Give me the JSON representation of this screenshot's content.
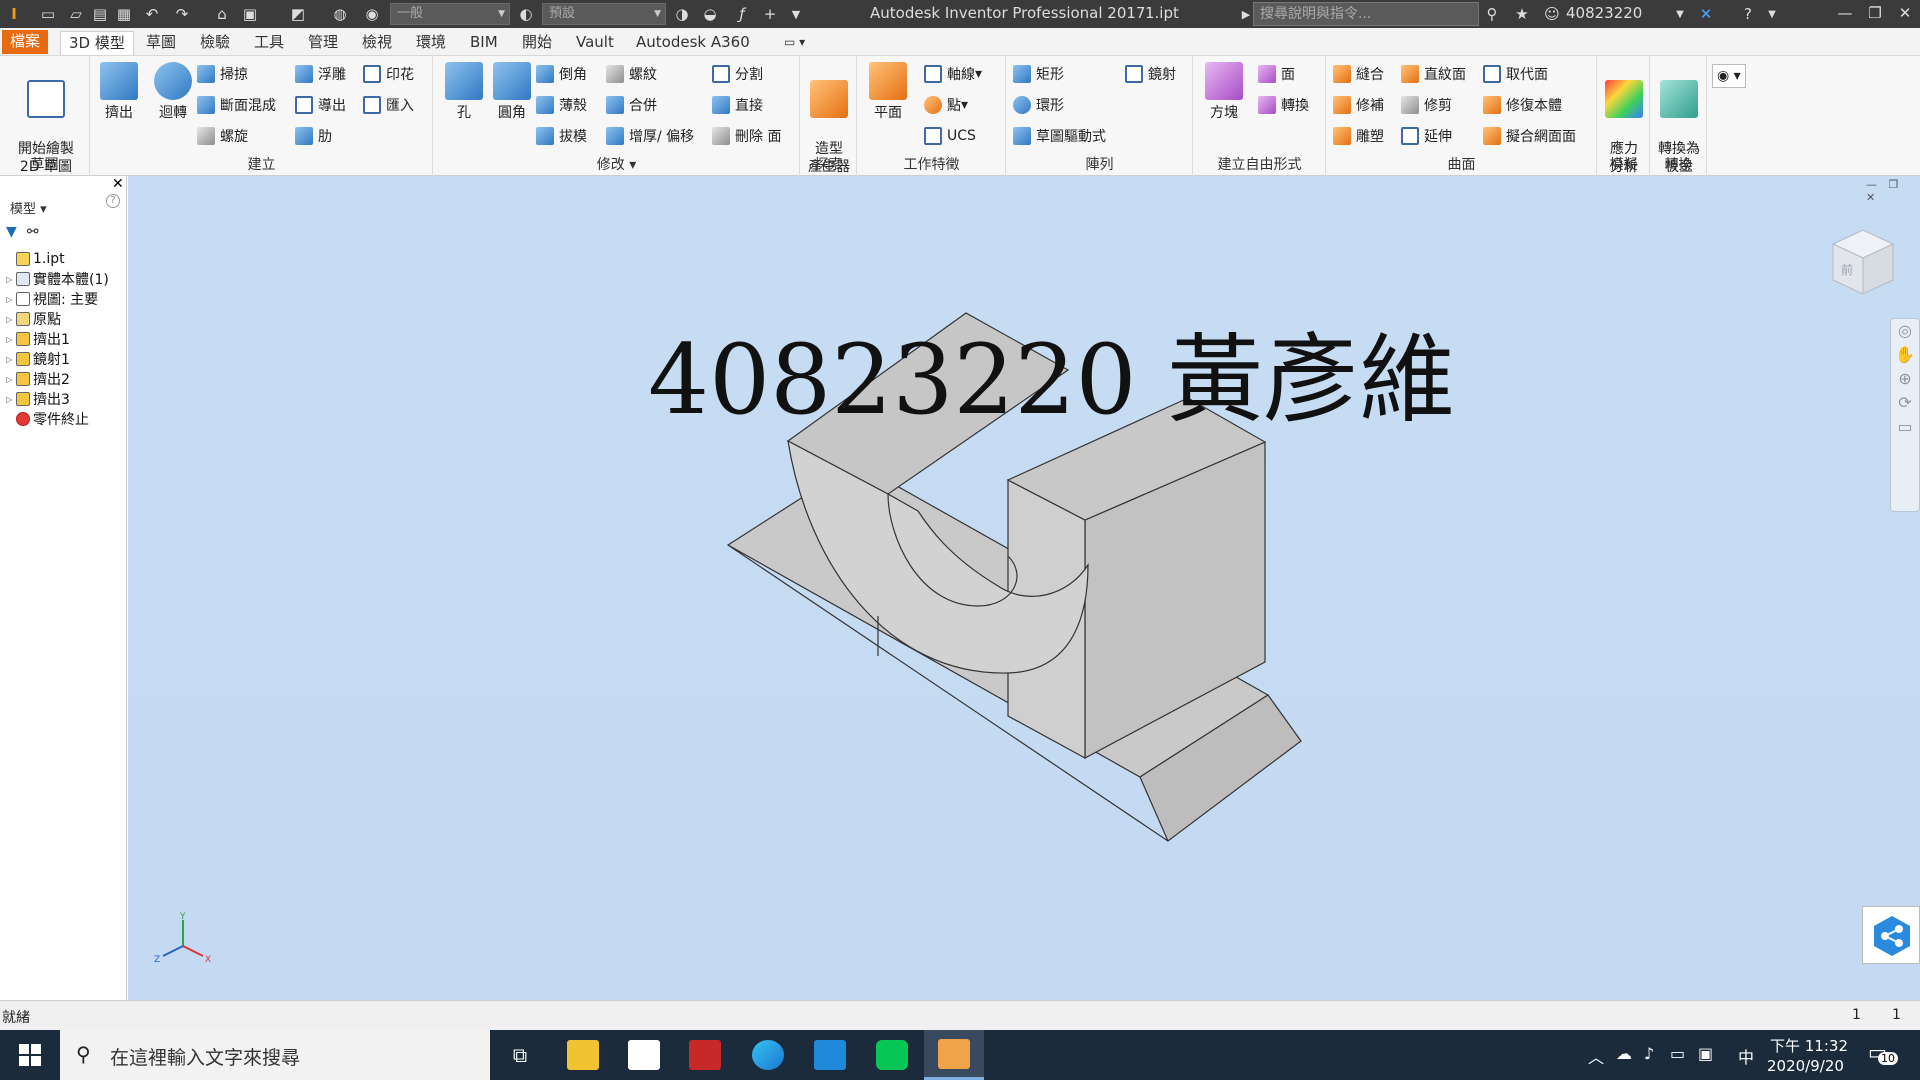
{
  "titlebar": {
    "material_combo": "一般",
    "appearance_combo": "預設",
    "app_title": "Autodesk Inventor Professional 2017",
    "file_title": "1.ipt",
    "help_placeholder": "搜尋說明與指令...",
    "user": "40823220"
  },
  "tabs": [
    "檔案",
    "3D 模型",
    "草圖",
    "檢驗",
    "工具",
    "管理",
    "檢視",
    "環境",
    "BIM",
    "開始",
    "Vault",
    "Autodesk A360"
  ],
  "ribbon": {
    "sketch": {
      "title": "草圖",
      "start_2d_sketch": "開始繪製\n2D 草圖"
    },
    "create": {
      "title": "建立",
      "extrude": "擠出",
      "revolve": "迴轉",
      "sweep": "掃掠",
      "loft": "斷面混成",
      "coil": "螺旋",
      "emboss": "浮雕",
      "derive": "導出",
      "rib": "肋",
      "decal": "印花",
      "import": "匯入"
    },
    "modify": {
      "title": "修改",
      "hole": "孔",
      "fillet": "圓角",
      "chamfer": "倒角",
      "shell": "薄殼",
      "draft": "拔模",
      "thread": "螺紋",
      "combine": "合併",
      "thicken": "增厚/ 偏移",
      "split": "分割",
      "direct": "直接",
      "delete_face": "刪除 面"
    },
    "explore": {
      "title": "探索",
      "shape_generator": "造型\n產生器"
    },
    "work_features": {
      "title": "工作特徵",
      "plane": "平面",
      "axis": "軸線",
      "point": "點",
      "ucs": "UCS"
    },
    "pattern": {
      "title": "陣列",
      "rectangular": "矩形",
      "circular": "環形",
      "sketch_driven": "草圖驅動式",
      "mirror": "鏡射"
    },
    "freeform": {
      "title": "建立自由形式",
      "box": "方塊",
      "face": "面",
      "convert": "轉換"
    },
    "surface": {
      "title": "曲面",
      "stitch": "縫合",
      "patch": "修補",
      "sculpt": "雕塑",
      "ruled": "直紋面",
      "trim": "修剪",
      "extend": "延伸",
      "replace_face": "取代面",
      "repair_bodies": "修復本體",
      "fit_mesh": "擬合網面面"
    },
    "simulation": {
      "title": "模擬",
      "stress_analysis": "應力\n分析"
    },
    "convert": {
      "title": "轉換",
      "convert_sheet_metal": "轉換為\n板金"
    }
  },
  "browser": {
    "title": "模型",
    "items": [
      {
        "label": "1.ipt",
        "expand": false
      },
      {
        "label": "實體本體(1)",
        "expand": true
      },
      {
        "label": "視圖: 主要",
        "expand": true
      },
      {
        "label": "原點",
        "expand": true
      },
      {
        "label": "擠出1",
        "expand": true
      },
      {
        "label": "鏡射1",
        "expand": true
      },
      {
        "label": "擠出2",
        "expand": true
      },
      {
        "label": "擠出3",
        "expand": true
      },
      {
        "label": "零件終止",
        "expand": false
      }
    ]
  },
  "viewport": {
    "watermark": "40823220 黃彥維",
    "viewcube_label": "前"
  },
  "statusbar": {
    "text": "就緒",
    "count_a": "1",
    "count_b": "1"
  },
  "taskbar": {
    "search_placeholder": "在這裡輸入文字來搜尋",
    "ime": "中",
    "time": "下午 11:32",
    "date": "2020/9/20",
    "notifications": "10"
  }
}
